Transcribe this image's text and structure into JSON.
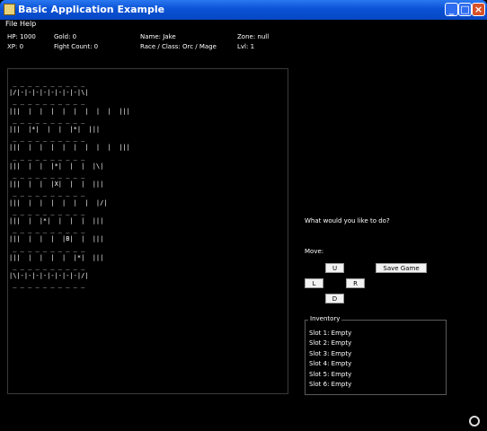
{
  "window": {
    "title": "Basic Application Example",
    "controls": {
      "minimize": "_",
      "maximize": "□",
      "close": "×"
    }
  },
  "menu": [
    "File",
    "Help"
  ],
  "stats": {
    "hp": "HP: 1000",
    "gold": "Gold: 0",
    "name": "Name:  Jake",
    "zone": "Zone: null",
    "xp": "XP: 0",
    "fight_count": "Fight Count:  0",
    "race_class": "Race / Class:  Orc / Mage",
    "lvl": "Lvl: 1"
  },
  "map": {
    "rows": [
      " _ _ _ _ _ _ _ _ _ _",
      "|/|-|-|-|-|-|-|-|-|\\|",
      " _ _ _ _ _ _ _ _ _ _",
      "|||  |  |  |  |  |  |  |  |  |||",
      " _ _ _ _ _ _ _ _ _ _",
      "|||  |*|  |  |  |*|  |||",
      " _ _ _ _ _ _ _ _ _ _",
      "|||  |  |  |  |  |  |  |  |  |||",
      " _ _ _ _ _ _ _ _ _ _",
      "|||  |  |  |*|  |  |  |\\|",
      " _ _ _ _ _ _ _ _ _ _",
      "|||  |  |  |X|  |  |  |||",
      " _ _ _ _ _ _ _ _ _ _",
      "|||  |  |  |  |  |  |  |/|",
      " _ _ _ _ _ _ _ _ _ _",
      "|||  |  |*|  |  |  |  |||",
      " _ _ _ _ _ _ _ _ _ _",
      "|||  |  |  |  |B|  |  |||",
      " _ _ _ _ _ _ _ _ _ _",
      "|||  |  |  |  |  |*|  |||",
      " _ _ _ _ _ _ _ _ _ _",
      "|\\|-|-|-|-|-|-|-|-|/|",
      " _ _ _ _ _ _ _ _ _ _"
    ]
  },
  "prompt": "What would you like to do?",
  "move_label": "Move:",
  "buttons": {
    "up": "U",
    "left": "L",
    "right": "R",
    "down": "D",
    "save": "Save Game"
  },
  "inventory": {
    "title": "Inventory",
    "slots": [
      "Slot 1:  Empty",
      "Slot 2:  Empty",
      "Slot 3:  Empty",
      "Slot 4:  Empty",
      "Slot 5:  Empty",
      "Slot 6:  Empty"
    ]
  }
}
